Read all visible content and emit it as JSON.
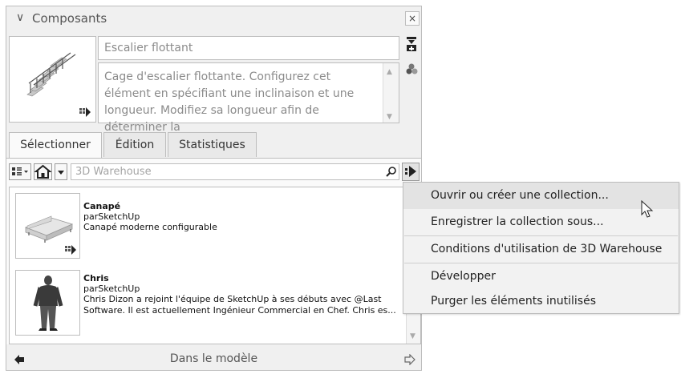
{
  "panel": {
    "title": "Composants",
    "component_name": "Escalier flottant",
    "component_description": "Cage d'escalier flottante. Configurez cet élément en spécifiant une inclinaison et une longueur. Modifiez sa longueur afin de déterminer la"
  },
  "tabs": [
    {
      "label": "Sélectionner"
    },
    {
      "label": "Édition"
    },
    {
      "label": "Statistiques"
    }
  ],
  "search": {
    "placeholder": "3D Warehouse"
  },
  "items": [
    {
      "title": "Canapé",
      "author": "parSketchUp",
      "desc": "Canapé moderne configurable"
    },
    {
      "title": "Chris",
      "author": "parSketchUp",
      "desc": "Chris Dizon a rejoint l'équipe de SketchUp à ses débuts avec @Last Software. Il est actuellement Ingénieur Commercial en Chef. Chris es..."
    }
  ],
  "footer": {
    "label": "Dans le modèle"
  },
  "menu": {
    "items": [
      {
        "label": "Ouvrir ou créer une collection..."
      },
      {
        "label": "Enregistrer la collection sous..."
      },
      {
        "label": "Conditions d'utilisation de 3D Warehouse"
      },
      {
        "label": "Développer"
      },
      {
        "label": "Purger les éléments inutilisés"
      }
    ]
  }
}
